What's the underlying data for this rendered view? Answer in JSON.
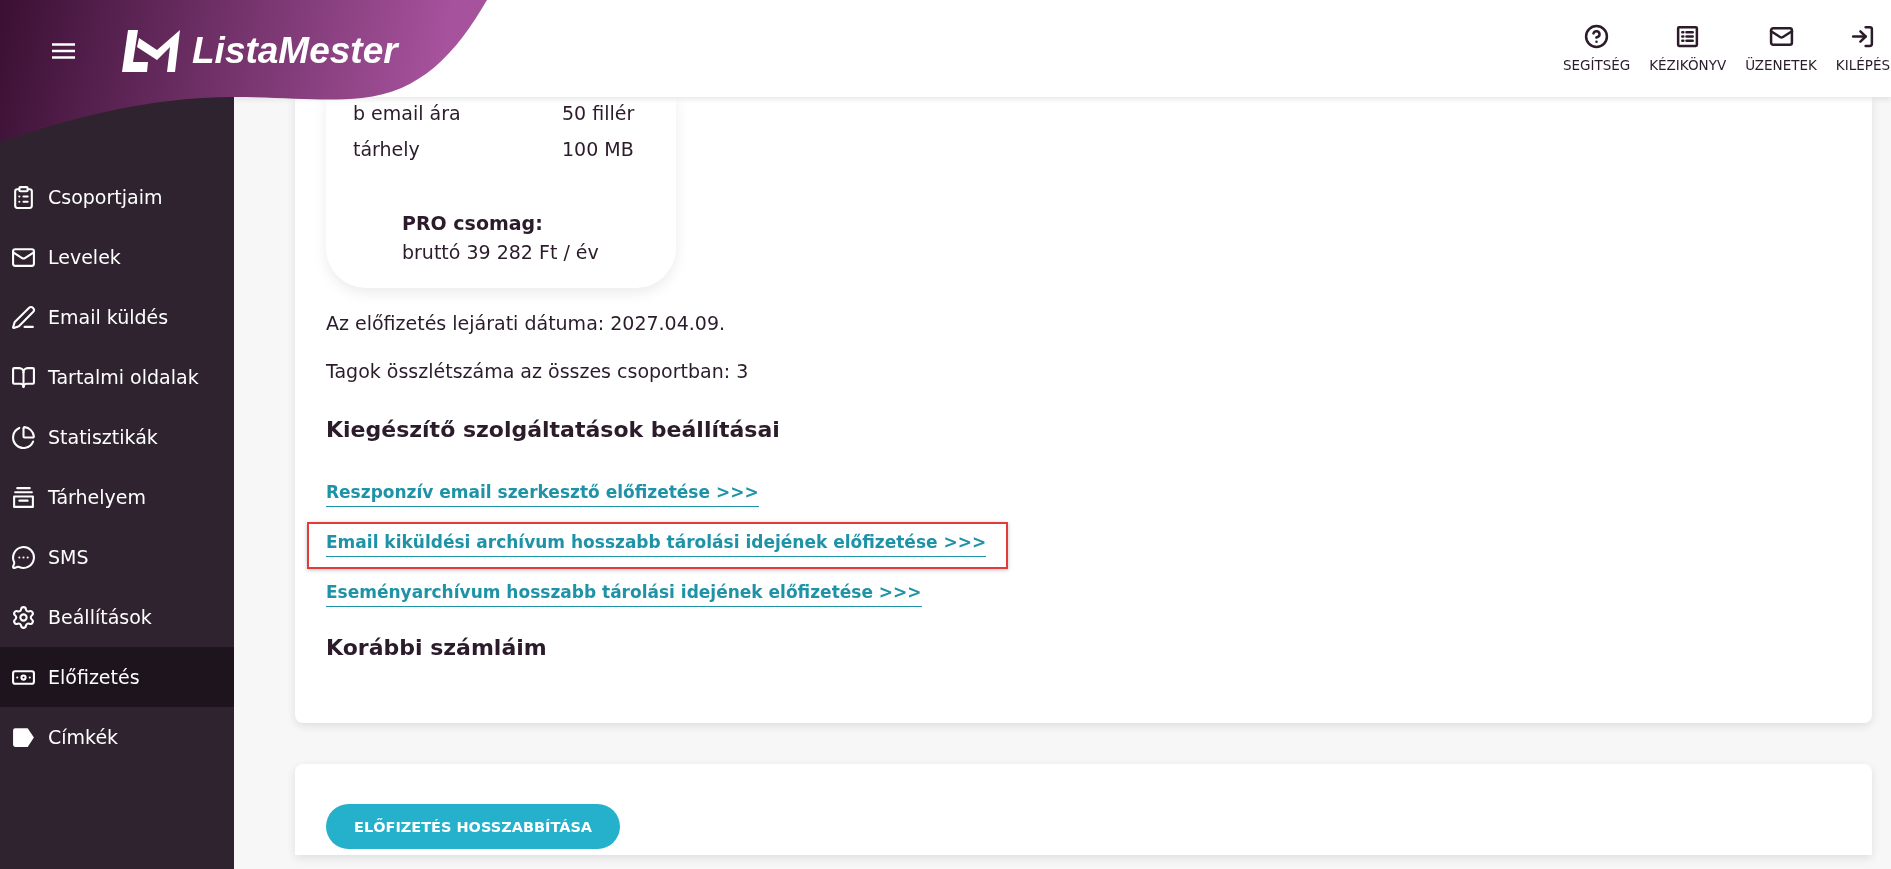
{
  "header": {
    "logo": "ListaMester",
    "actions": [
      {
        "label": "SEGÍTSÉG"
      },
      {
        "label": "KÉZIKÖNYV"
      },
      {
        "label": "ÜZENETEK"
      },
      {
        "label": "KILÉPÉS"
      }
    ]
  },
  "sidebar": {
    "items": [
      {
        "label": "Csoportjaim",
        "selected": false
      },
      {
        "label": "Levelek",
        "selected": false
      },
      {
        "label": "Email küldés",
        "selected": false
      },
      {
        "label": "Tartalmi oldalak",
        "selected": false
      },
      {
        "label": "Statisztikák",
        "selected": false
      },
      {
        "label": "Tárhelyem",
        "selected": false
      },
      {
        "label": "SMS",
        "selected": false
      },
      {
        "label": "Beállítások",
        "selected": false
      },
      {
        "label": "Előfizetés",
        "selected": true
      },
      {
        "label": "Címkék",
        "selected": false
      }
    ]
  },
  "plan_card": {
    "rows": [
      {
        "label": "b email ára",
        "value": "50 fillér"
      },
      {
        "label": "tárhely",
        "value": "100 MB"
      }
    ],
    "package": {
      "title": "PRO csomag:",
      "price": "bruttó 39 282 Ft / év"
    }
  },
  "info_lines": [
    "Az előfizetés lejárati dátuma: 2027.04.09.",
    "Tagok összlétszáma az összes csoportban: 3"
  ],
  "addons": {
    "title": "Kiegészítő szolgáltatások beállításai",
    "links": [
      {
        "label": "Reszponzív email szerkesztő előfizetése >>>",
        "highlighted": false
      },
      {
        "label": "Email kiküldési archívum hosszabb tárolási idejének előfizetése >>>",
        "highlighted": true
      },
      {
        "label": "Eseményarchívum hosszabb tárolási idejének előfizetése >>>",
        "highlighted": false
      }
    ]
  },
  "invoices": {
    "title": "Korábbi számláim"
  },
  "renew_button": {
    "label": "ELŐFIZETÉS HOSSZABBÍTÁSA"
  }
}
